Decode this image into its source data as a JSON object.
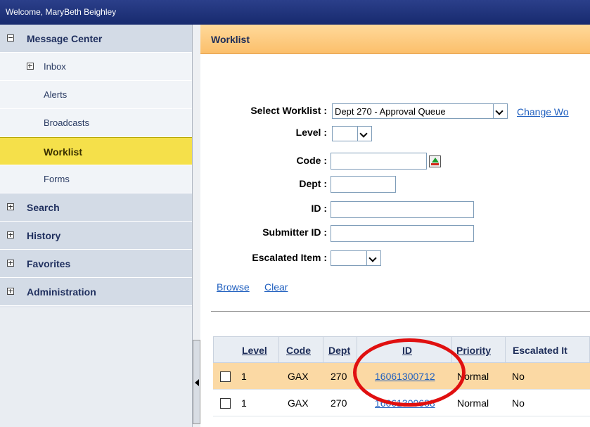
{
  "topbar": {
    "welcome": "Welcome, MaryBeth Beighley"
  },
  "sidebar": {
    "items": [
      {
        "label": "Message Center",
        "type": "header",
        "expander": "minus"
      },
      {
        "label": "Inbox",
        "type": "sub",
        "expander": "plus"
      },
      {
        "label": "Alerts",
        "type": "sub"
      },
      {
        "label": "Broadcasts",
        "type": "sub"
      },
      {
        "label": "Worklist",
        "type": "active"
      },
      {
        "label": "Forms",
        "type": "sub"
      },
      {
        "label": "Search",
        "type": "header",
        "expander": "plus"
      },
      {
        "label": "History",
        "type": "header",
        "expander": "plus"
      },
      {
        "label": "Favorites",
        "type": "header",
        "expander": "plus"
      },
      {
        "label": "Administration",
        "type": "header",
        "expander": "plus"
      }
    ]
  },
  "main": {
    "title": "Worklist",
    "form": {
      "select_worklist_label": "Select Worklist :",
      "select_worklist_value": "Dept 270 - Approval Queue",
      "change_link": "Change Wo",
      "level_label": "Level :",
      "level_value": "",
      "code_label": "Code :",
      "code_value": "",
      "dept_label": "Dept :",
      "dept_value": "",
      "id_label": "ID :",
      "id_value": "",
      "submitter_label": "Submitter ID :",
      "submitter_value": "",
      "escalated_label": "Escalated Item :",
      "escalated_value": "",
      "browse": "Browse",
      "clear": "Clear"
    },
    "table": {
      "headers": [
        "Level",
        "Code",
        "Dept",
        "ID",
        "Priority",
        "Escalated It"
      ],
      "rows": [
        {
          "level": "1",
          "code": "GAX",
          "dept": "270",
          "id": "16061300712",
          "priority": "Normal",
          "escalated": "No",
          "highlight": true
        },
        {
          "level": "1",
          "code": "GAX",
          "dept": "270",
          "id": "16061300688",
          "priority": "Normal",
          "escalated": "No",
          "highlight": false
        }
      ]
    }
  },
  "colors": {
    "topbar": "#1f3379",
    "active_nav": "#f5e04a",
    "header_strip": "#fbc97f",
    "link": "#1f5fbf",
    "highlight_row": "#fbd9a4",
    "annotation": "#e01010"
  }
}
